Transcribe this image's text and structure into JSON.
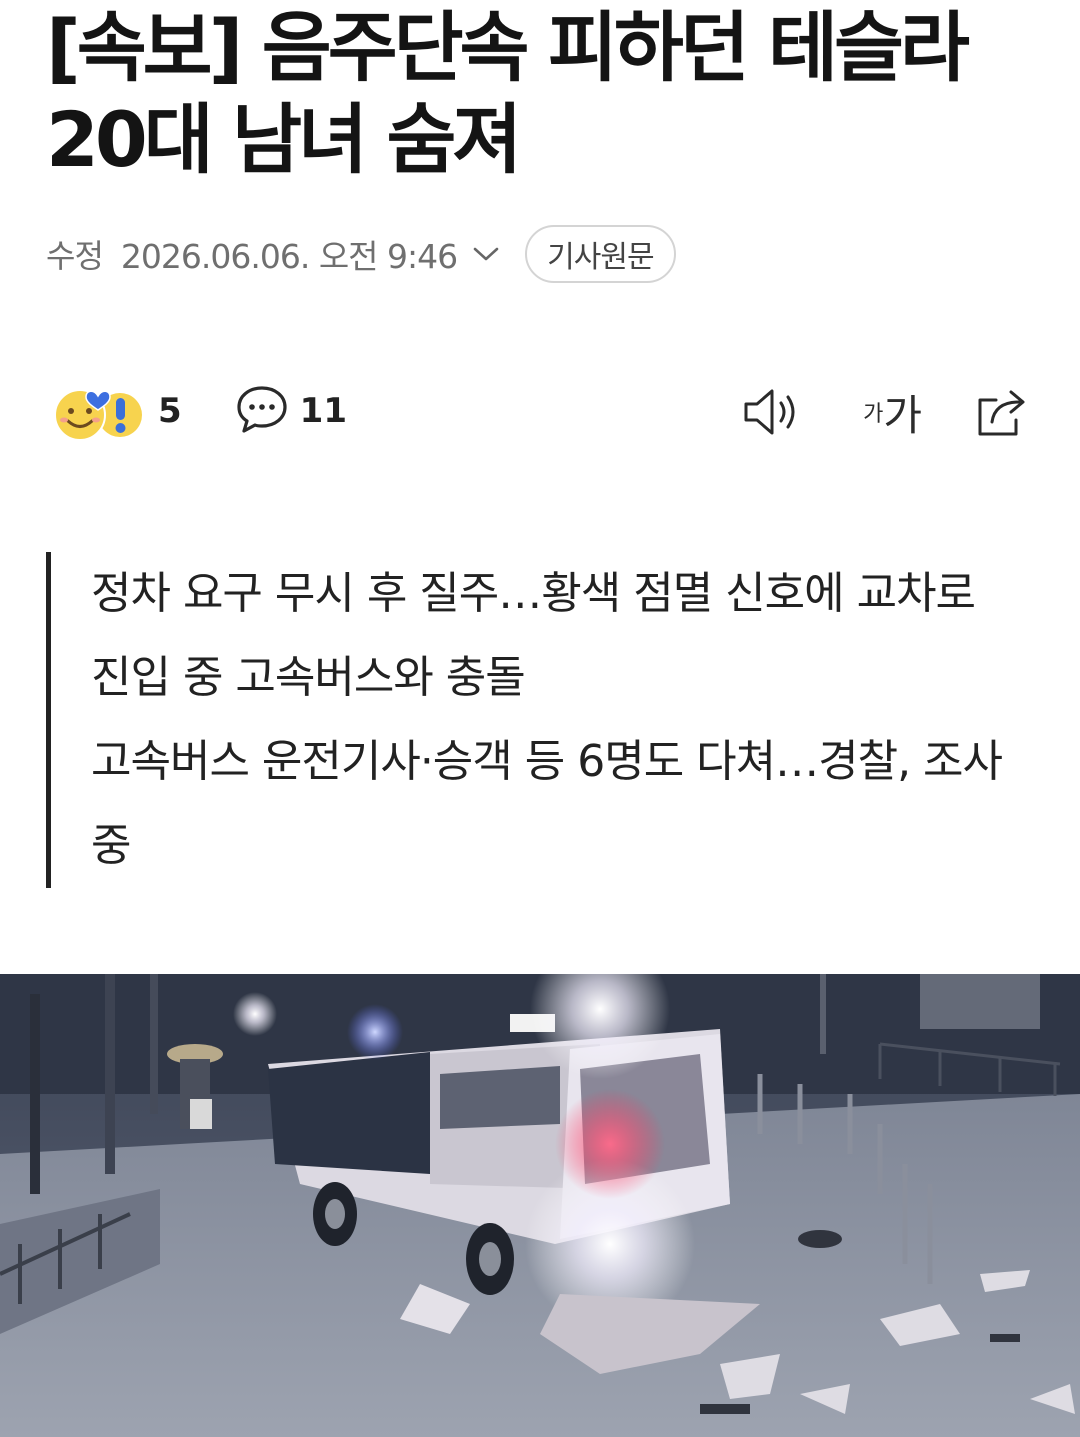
{
  "article": {
    "headline": "[속보] 음주단속 피하던 테슬라 20대 남녀 숨져",
    "meta_label": "수정",
    "timestamp": "2026.06.06. 오전 9:46",
    "original_button": "기사원문"
  },
  "reactions": {
    "reaction_count": "5",
    "comment_count": "11",
    "reaction_icons": [
      "smile-emoji-icon",
      "heart-icon",
      "exclamation-emoji-icon"
    ]
  },
  "toolbar": {
    "font_small": "가",
    "font_large": "가",
    "icons": [
      "speaker-icon",
      "font-size-icon",
      "share-icon"
    ]
  },
  "summary": {
    "lines": [
      "정차 요구 무시 후 질주…황색 점멸 신호에 교차로 진입 중 고속버스와 충돌",
      "고속버스 운전기사·승객 등 6명도 다쳐…경찰, 조사 중"
    ]
  },
  "colors": {
    "text_primary": "#141414",
    "text_meta": "#6f6f6f",
    "button_border": "#d4d4d4",
    "summary_bar": "#222222",
    "emoji_yellow": "#f7d34e",
    "heart_blue": "#3d6fe0",
    "exclamation_blue": "#3b6fd8"
  }
}
